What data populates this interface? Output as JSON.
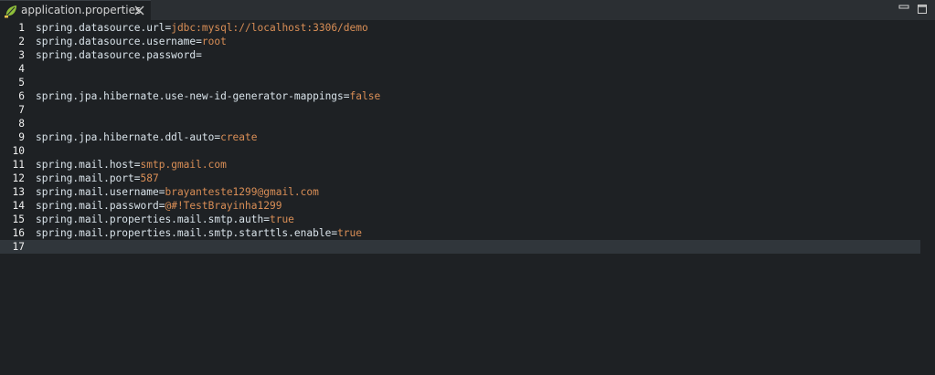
{
  "tab": {
    "label": "application.properties",
    "icon": "spring-leaf-icon",
    "close_icon": "close-icon"
  },
  "window_controls": {
    "minimize_icon": "minimize-icon",
    "maximize_icon": "maximize-icon"
  },
  "colors": {
    "key": "#d9e3ea",
    "value": "#d98e56",
    "background": "#1e2124",
    "current_line": "#30363b"
  },
  "editor": {
    "current_line": 17,
    "lines": [
      {
        "num": "1",
        "key": "spring.datasource.url",
        "eq": "=",
        "value": "jdbc:mysql://localhost:3306/demo"
      },
      {
        "num": "2",
        "key": "spring.datasource.username",
        "eq": "=",
        "value": "root"
      },
      {
        "num": "3",
        "key": "spring.datasource.password",
        "eq": "=",
        "value": ""
      },
      {
        "num": "4",
        "key": "",
        "eq": "",
        "value": ""
      },
      {
        "num": "5",
        "key": "",
        "eq": "",
        "value": ""
      },
      {
        "num": "6",
        "key": "spring.jpa.hibernate.use-new-id-generator-mappings",
        "eq": "=",
        "value": "false"
      },
      {
        "num": "7",
        "key": "",
        "eq": "",
        "value": ""
      },
      {
        "num": "8",
        "key": "",
        "eq": "",
        "value": ""
      },
      {
        "num": "9",
        "key": "spring.jpa.hibernate.ddl-auto",
        "eq": "=",
        "value": "create"
      },
      {
        "num": "10",
        "key": "",
        "eq": "",
        "value": ""
      },
      {
        "num": "11",
        "key": "spring.mail.host",
        "eq": "=",
        "value": "smtp.gmail.com"
      },
      {
        "num": "12",
        "key": "spring.mail.port",
        "eq": "=",
        "value": "587"
      },
      {
        "num": "13",
        "key": "spring.mail.username",
        "eq": "=",
        "value": "brayanteste1299@gmail.com"
      },
      {
        "num": "14",
        "key": "spring.mail.password",
        "eq": "=",
        "value": "@#!TestBrayinha1299"
      },
      {
        "num": "15",
        "key": "spring.mail.properties.mail.smtp.auth",
        "eq": "=",
        "value": "true"
      },
      {
        "num": "16",
        "key": "spring.mail.properties.mail.smtp.starttls.enable",
        "eq": "=",
        "value": "true"
      },
      {
        "num": "17",
        "key": "",
        "eq": "",
        "value": ""
      }
    ]
  }
}
